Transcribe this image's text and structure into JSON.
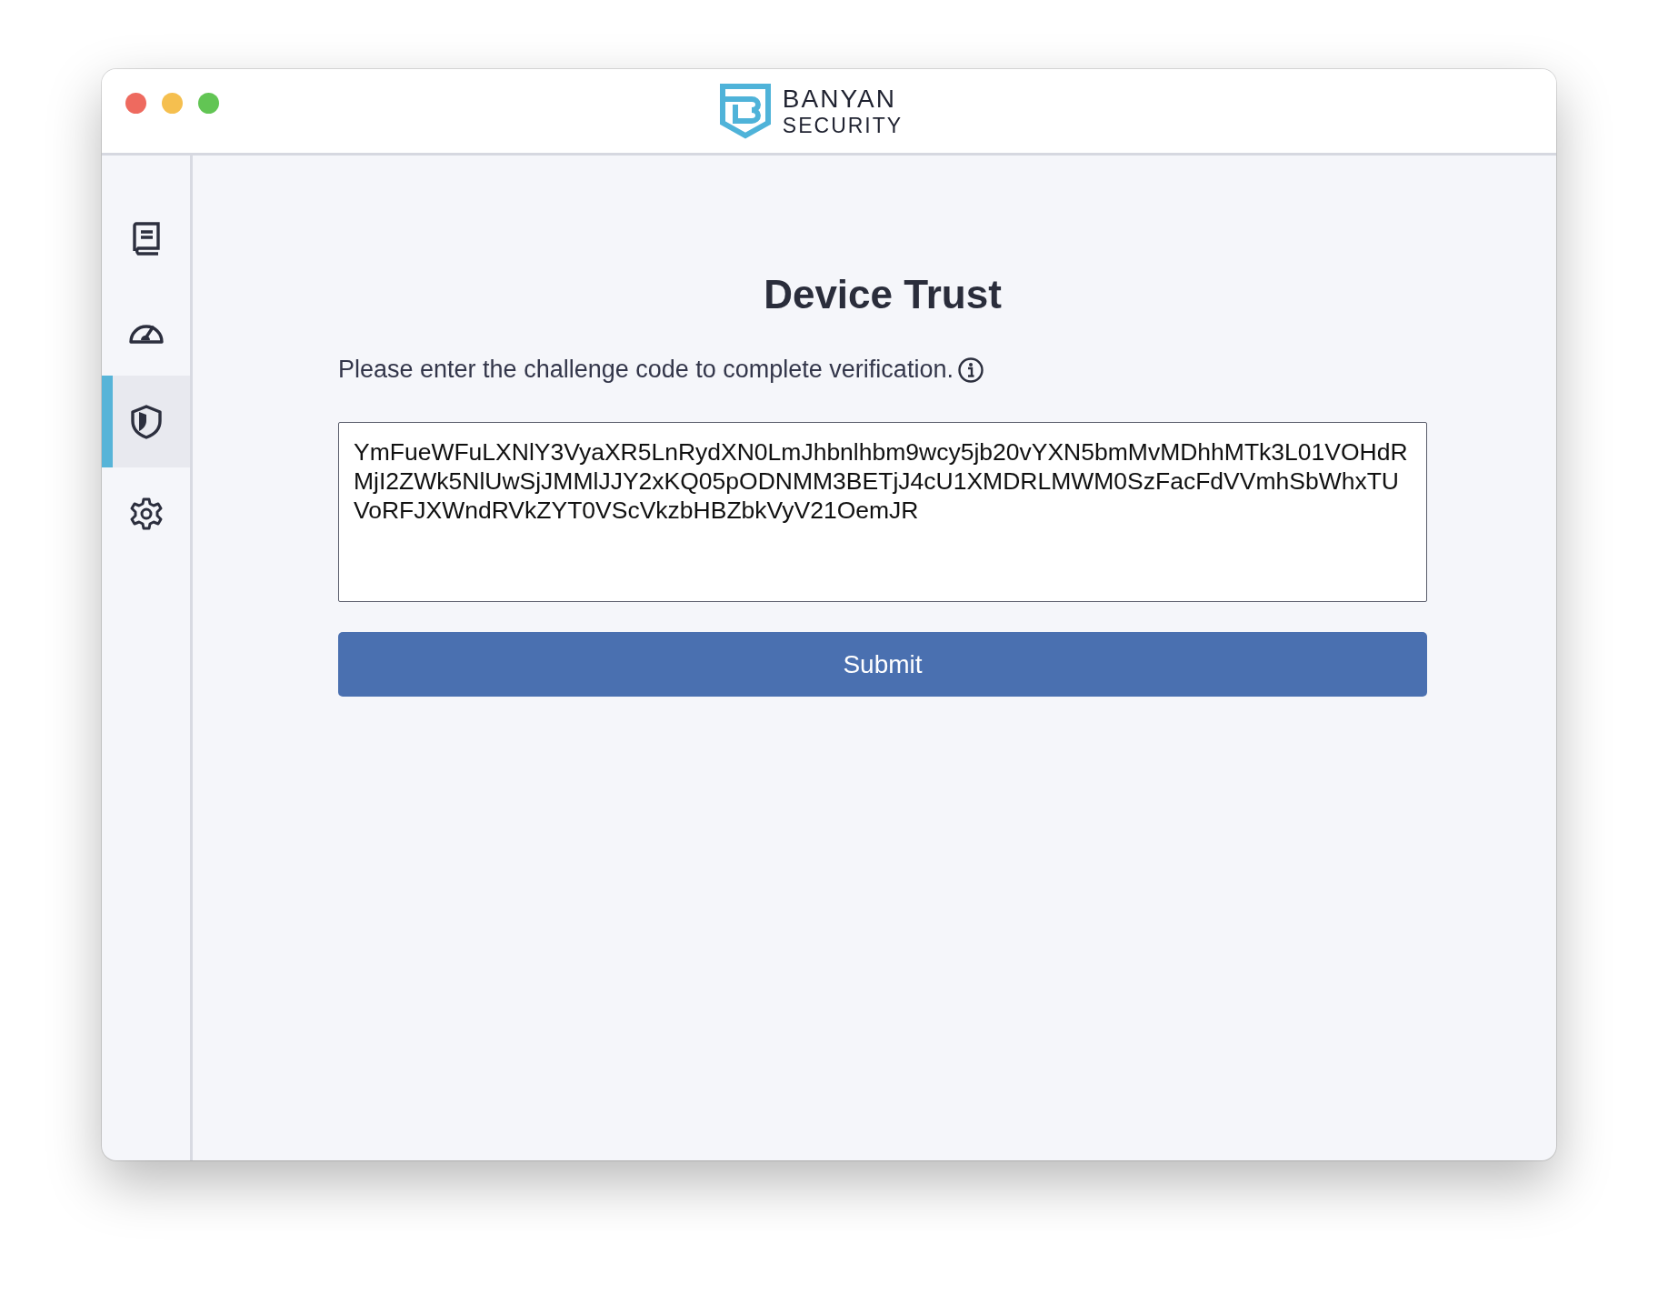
{
  "window": {
    "traffic_lights": [
      {
        "color": "#ee6a5f"
      },
      {
        "color": "#f5bf4f"
      },
      {
        "color": "#62c554"
      }
    ]
  },
  "logo": {
    "line_1": "BANYAN",
    "line_2": "SECURITY"
  },
  "sidebar": {
    "items": [
      {
        "kind": "book",
        "selected": false
      },
      {
        "kind": "gauge",
        "selected": false
      },
      {
        "kind": "shield",
        "selected": true
      },
      {
        "kind": "gear",
        "selected": false
      }
    ]
  },
  "page": {
    "title": "Device Trust",
    "description": "Please enter the challenge code to complete verification.",
    "code_field": {
      "value": "YmFueWFuLXNlY3VyaXR5LnRydXN0LmJhbnlhbm9wcy5jb20vYXN5bmMvMDhhMTk3L01VOHdRMjI2ZWk5NlUwSjJMMlJJY2xKQ05pODNMM3BETjJ4cU1XMDRLMWM0SzFacFdVVmhSbWhxTUVoRFJXWndRVkZYT0VScVkzbHBZbkVyV21OemJR"
    },
    "submit_button": "Submit"
  }
}
